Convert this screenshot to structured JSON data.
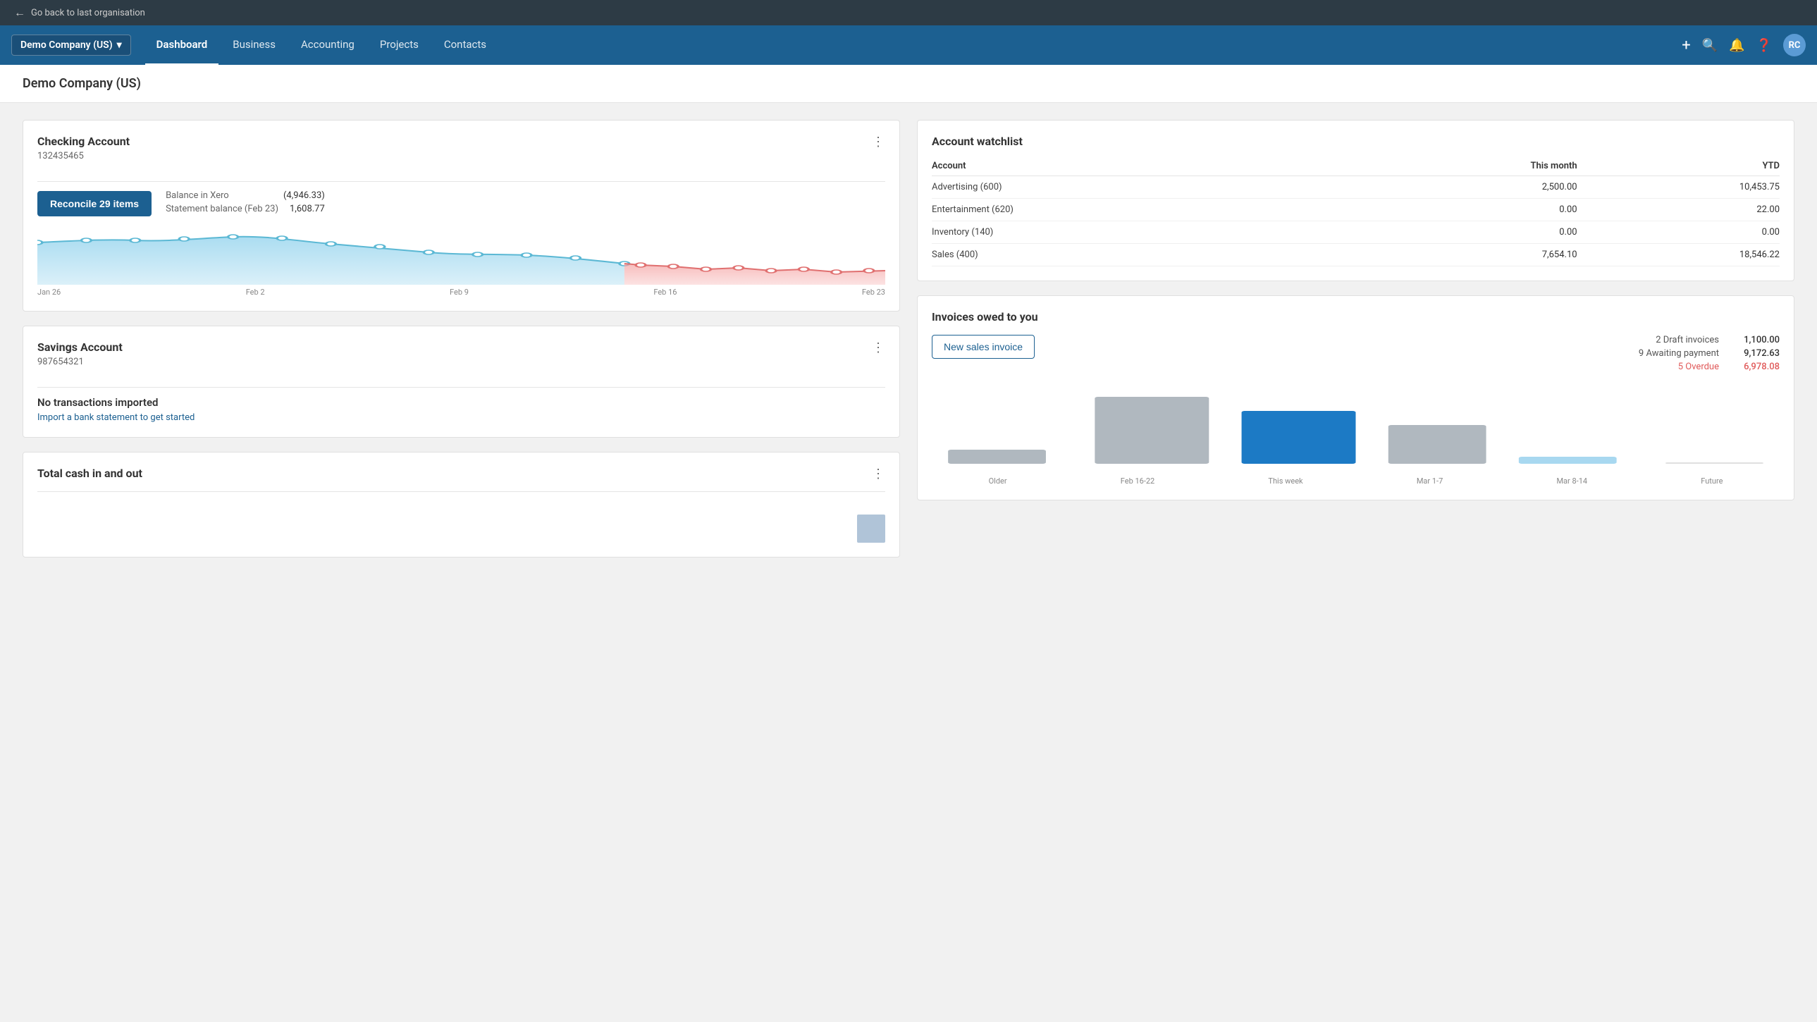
{
  "topbar": {
    "back_label": "Go back to last organisation"
  },
  "nav": {
    "org_name": "Demo Company (US)",
    "links": [
      {
        "label": "Dashboard",
        "active": true
      },
      {
        "label": "Business",
        "active": false
      },
      {
        "label": "Accounting",
        "active": false
      },
      {
        "label": "Projects",
        "active": false
      },
      {
        "label": "Contacts",
        "active": false
      }
    ],
    "avatar_initials": "RC"
  },
  "page": {
    "title": "Demo Company (US)"
  },
  "checking_account": {
    "title": "Checking Account",
    "account_number": "132435465",
    "reconcile_label": "Reconcile 29 items",
    "balance_in_xero_label": "Balance in Xero",
    "balance_in_xero_value": "(4,946.33)",
    "statement_balance_label": "Statement balance (Feb 23)",
    "statement_balance_value": "1,608.77",
    "chart_labels": [
      "Jan 26",
      "Feb 2",
      "Feb 9",
      "Feb 16",
      "Feb 23"
    ]
  },
  "savings_account": {
    "title": "Savings Account",
    "account_number": "987654321",
    "no_transactions_label": "No transactions imported",
    "import_link_label": "Import a bank statement to get started"
  },
  "total_cash": {
    "title": "Total cash in and out"
  },
  "account_watchlist": {
    "title": "Account watchlist",
    "columns": [
      "Account",
      "This month",
      "YTD"
    ],
    "rows": [
      {
        "account": "Advertising (600)",
        "this_month": "2,500.00",
        "ytd": "10,453.75"
      },
      {
        "account": "Entertainment (620)",
        "this_month": "0.00",
        "ytd": "22.00"
      },
      {
        "account": "Inventory (140)",
        "this_month": "0.00",
        "ytd": "0.00"
      },
      {
        "account": "Sales (400)",
        "this_month": "7,654.10",
        "ytd": "18,546.22"
      }
    ]
  },
  "invoices_owed": {
    "title": "Invoices owed to you",
    "new_invoice_label": "New sales invoice",
    "stats": [
      {
        "label": "2 Draft invoices",
        "value": "1,100.00",
        "overdue": false
      },
      {
        "label": "9 Awaiting payment",
        "value": "9,172.63",
        "overdue": false
      },
      {
        "label": "5 Overdue",
        "value": "6,978.08",
        "overdue": true
      }
    ],
    "bar_chart": {
      "labels": [
        "Older",
        "Feb 16-22",
        "This week",
        "Mar 1-7",
        "Mar 8-14",
        "Future"
      ],
      "values": [
        15,
        85,
        65,
        42,
        8,
        0
      ],
      "colors": [
        "#b0b8bf",
        "#b0b8bf",
        "#1c7ac5",
        "#b0b8bf",
        "#b0d8f5",
        "#b0b8bf"
      ]
    }
  }
}
